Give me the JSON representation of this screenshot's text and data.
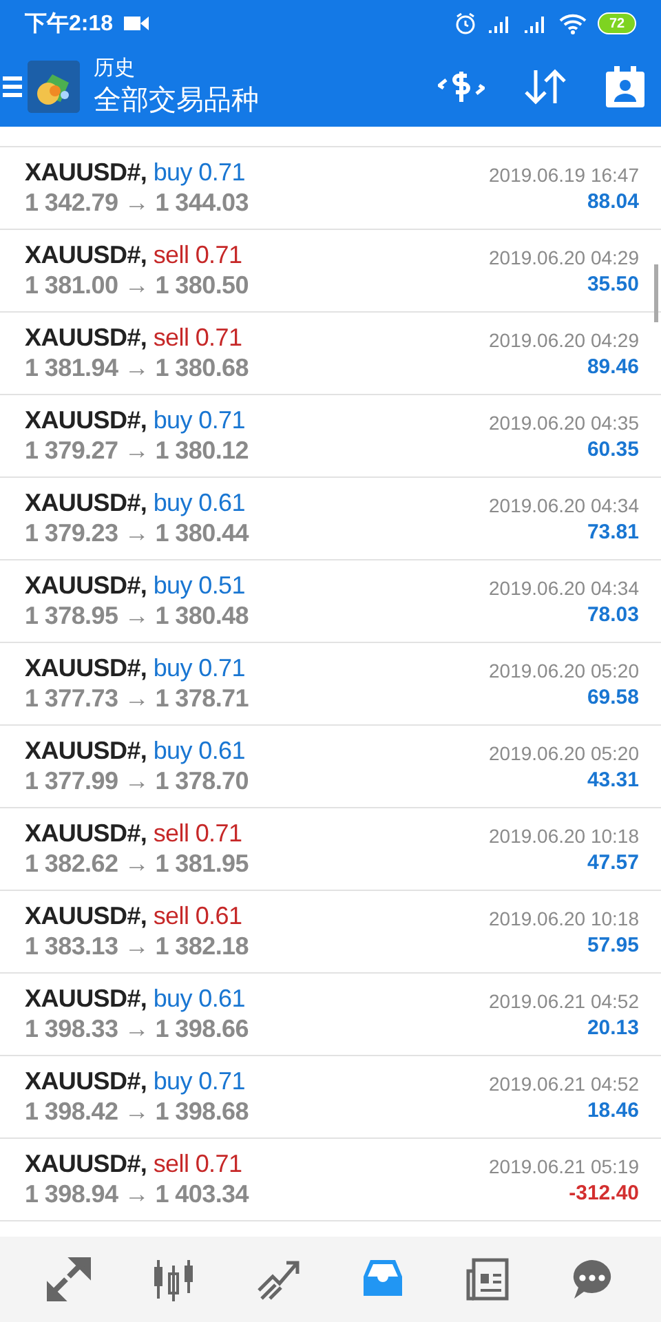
{
  "status_bar": {
    "time": "下午2:18",
    "battery": "72"
  },
  "app_bar": {
    "title": "历史",
    "subtitle": "全部交易品种"
  },
  "deals": [
    {
      "symbol": "XAUUSD#,",
      "order": "buy 0.71",
      "kind": "buy",
      "prices": "1 342.79 → 1 344.03",
      "time": "2019.06.19 16:47",
      "profit": "88.04",
      "negative": false
    },
    {
      "symbol": "XAUUSD#,",
      "order": "sell 0.71",
      "kind": "sell",
      "prices": "1 381.00 → 1 380.50",
      "time": "2019.06.20 04:29",
      "profit": "35.50",
      "negative": false
    },
    {
      "symbol": "XAUUSD#,",
      "order": "sell 0.71",
      "kind": "sell",
      "prices": "1 381.94 → 1 380.68",
      "time": "2019.06.20 04:29",
      "profit": "89.46",
      "negative": false
    },
    {
      "symbol": "XAUUSD#,",
      "order": "buy 0.71",
      "kind": "buy",
      "prices": "1 379.27 → 1 380.12",
      "time": "2019.06.20 04:35",
      "profit": "60.35",
      "negative": false
    },
    {
      "symbol": "XAUUSD#,",
      "order": "buy 0.61",
      "kind": "buy",
      "prices": "1 379.23 → 1 380.44",
      "time": "2019.06.20 04:34",
      "profit": "73.81",
      "negative": false
    },
    {
      "symbol": "XAUUSD#,",
      "order": "buy 0.51",
      "kind": "buy",
      "prices": "1 378.95 → 1 380.48",
      "time": "2019.06.20 04:34",
      "profit": "78.03",
      "negative": false
    },
    {
      "symbol": "XAUUSD#,",
      "order": "buy 0.71",
      "kind": "buy",
      "prices": "1 377.73 → 1 378.71",
      "time": "2019.06.20 05:20",
      "profit": "69.58",
      "negative": false
    },
    {
      "symbol": "XAUUSD#,",
      "order": "buy 0.61",
      "kind": "buy",
      "prices": "1 377.99 → 1 378.70",
      "time": "2019.06.20 05:20",
      "profit": "43.31",
      "negative": false
    },
    {
      "symbol": "XAUUSD#,",
      "order": "sell 0.71",
      "kind": "sell",
      "prices": "1 382.62 → 1 381.95",
      "time": "2019.06.20 10:18",
      "profit": "47.57",
      "negative": false
    },
    {
      "symbol": "XAUUSD#,",
      "order": "sell 0.61",
      "kind": "sell",
      "prices": "1 383.13 → 1 382.18",
      "time": "2019.06.20 10:18",
      "profit": "57.95",
      "negative": false
    },
    {
      "symbol": "XAUUSD#,",
      "order": "buy 0.61",
      "kind": "buy",
      "prices": "1 398.33 → 1 398.66",
      "time": "2019.06.21 04:52",
      "profit": "20.13",
      "negative": false
    },
    {
      "symbol": "XAUUSD#,",
      "order": "buy 0.71",
      "kind": "buy",
      "prices": "1 398.42 → 1 398.68",
      "time": "2019.06.21 04:52",
      "profit": "18.46",
      "negative": false
    },
    {
      "symbol": "XAUUSD#,",
      "order": "sell 0.71",
      "kind": "sell",
      "prices": "1 398.94 → 1 403.34",
      "time": "2019.06.21 05:19",
      "profit": "-312.40",
      "negative": true
    }
  ],
  "bottom_nav": [
    {
      "kind": "quotes",
      "selected": false
    },
    {
      "kind": "chart",
      "selected": false
    },
    {
      "kind": "trade",
      "selected": false
    },
    {
      "kind": "history",
      "selected": true
    },
    {
      "kind": "news",
      "selected": false
    },
    {
      "kind": "chat",
      "selected": false
    }
  ]
}
